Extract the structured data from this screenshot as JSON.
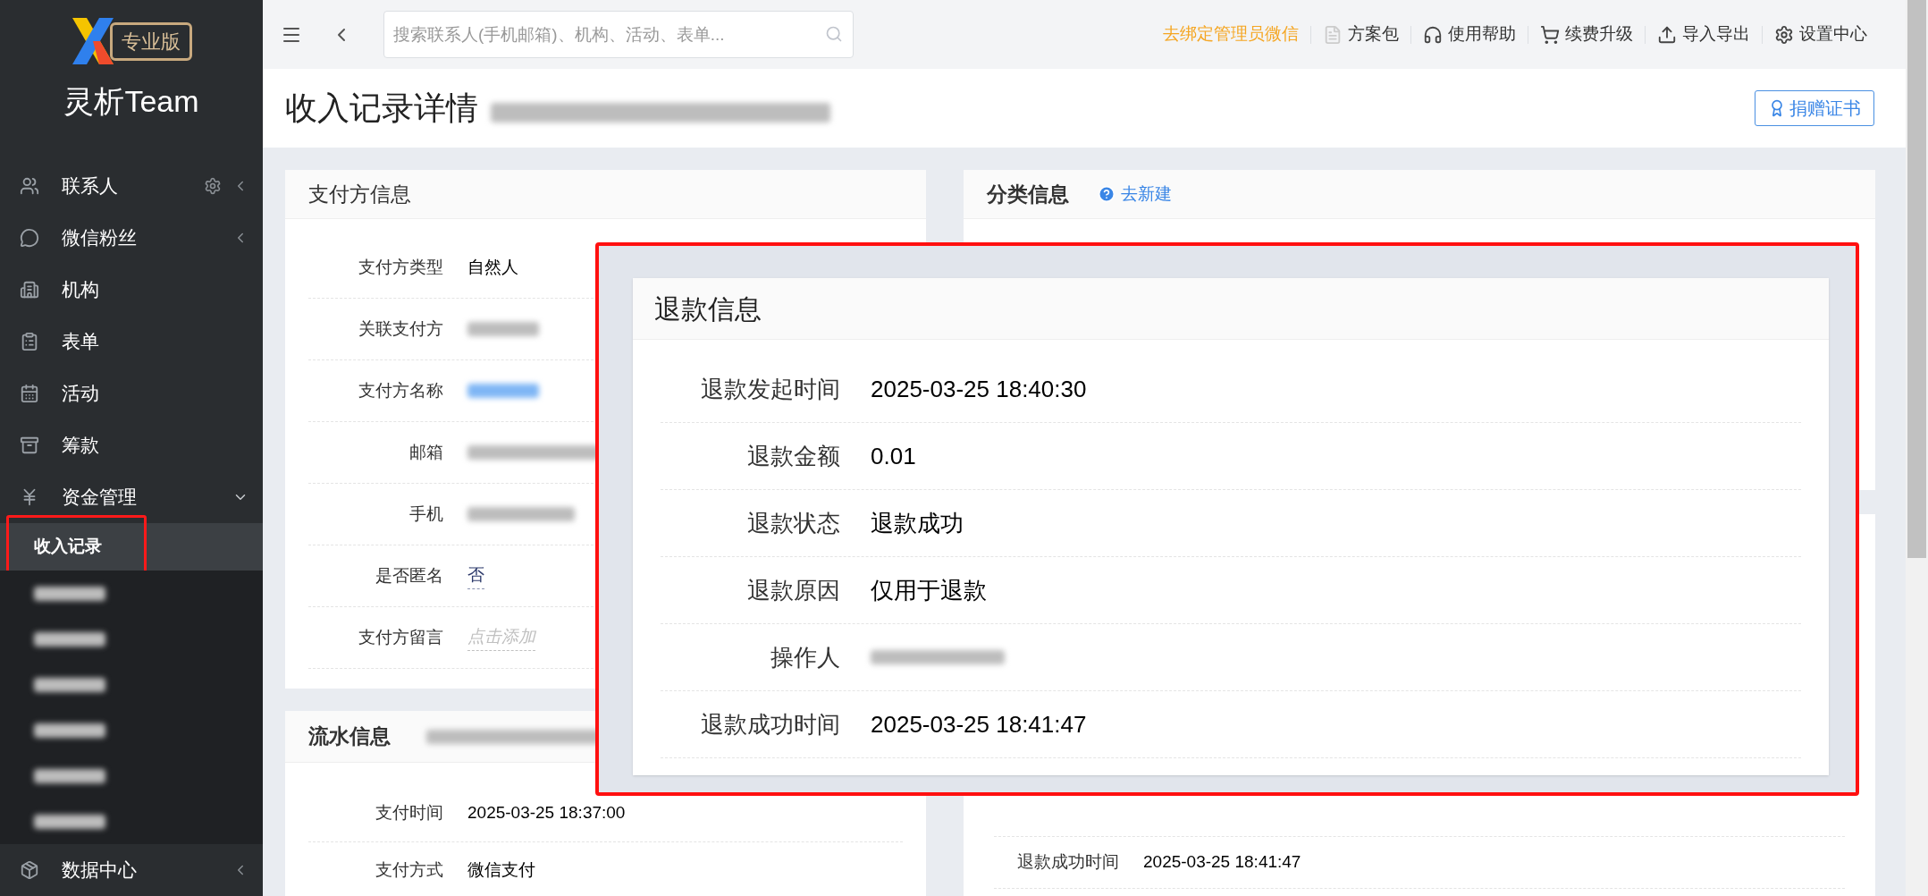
{
  "sidebar": {
    "logo_badge": "专业版",
    "brand": "灵析Team",
    "items": [
      {
        "label": "联系人",
        "settings": true,
        "expanded": false
      },
      {
        "label": "微信粉丝",
        "expanded": false
      },
      {
        "label": "机构"
      },
      {
        "label": "表单"
      },
      {
        "label": "活动"
      },
      {
        "label": "筹款"
      },
      {
        "label": "资金管理",
        "expanded": true,
        "children": [
          {
            "label": "收入记录",
            "selected": true,
            "highlighted": true,
            "redacted": false
          },
          {
            "redacted": true,
            "selected": false,
            "highlighted": false
          },
          {
            "redacted": true,
            "selected": false,
            "highlighted": false
          },
          {
            "redacted": true,
            "selected": false,
            "highlighted": false
          },
          {
            "redacted": true,
            "selected": false,
            "highlighted": false
          },
          {
            "redacted": true,
            "selected": false,
            "highlighted": false
          },
          {
            "redacted": true,
            "selected": false,
            "highlighted": false
          }
        ]
      },
      {
        "label": "数据中心",
        "expanded": false
      }
    ]
  },
  "top_bar": {
    "search": {
      "placeholder": "搜索联系人(手机邮箱)、机构、活动、表单..."
    },
    "links": [
      {
        "label": "去绑定管理员微信",
        "kind": "notice"
      },
      {
        "label": "方案包",
        "kind": "disabled"
      },
      {
        "label": "使用帮助",
        "kind": "normal"
      },
      {
        "label": "续费升级",
        "kind": "normal"
      },
      {
        "label": "导入导出",
        "kind": "normal"
      },
      {
        "label": "设置中心",
        "kind": "normal"
      }
    ]
  },
  "page": {
    "title": "收入记录详情",
    "subtitle_redacted": true,
    "button": "捐赠证书"
  },
  "payer_info": {
    "title": "支付方信息",
    "rows": [
      {
        "label": "支付方类型",
        "kind": "text",
        "value": "自然人"
      },
      {
        "label": "关联支付方",
        "kind": "redacted"
      },
      {
        "label": "支付方名称",
        "kind": "redacted_link"
      },
      {
        "label": "邮箱",
        "kind": "redacted"
      },
      {
        "label": "手机",
        "kind": "redacted"
      },
      {
        "label": "是否匿名",
        "kind": "editable",
        "value": "否"
      },
      {
        "label": "支付方留言",
        "kind": "placeholder",
        "value": "点击添加"
      }
    ]
  },
  "flow_info": {
    "title": "流水信息",
    "subtitle_redacted": true,
    "rows": [
      {
        "label": "支付时间",
        "kind": "text",
        "value": "2025-03-25 18:37:00"
      },
      {
        "label": "支付方式",
        "kind": "text",
        "value": "微信支付"
      }
    ]
  },
  "category_info": {
    "title": "分类信息",
    "link": "去新建"
  },
  "refund_info": {
    "rows": [
      {
        "label": "退款成功时间",
        "kind": "text",
        "value": "2025-03-25 18:41:47"
      }
    ]
  },
  "refund_zoom": {
    "highlighted": true,
    "title": "退款信息",
    "rows": [
      {
        "label": "退款发起时间",
        "kind": "text",
        "value": "2025-03-25 18:40:30"
      },
      {
        "label": "退款金额",
        "kind": "text",
        "value": "0.01"
      },
      {
        "label": "退款状态",
        "kind": "text",
        "value": "退款成功"
      },
      {
        "label": "退款原因",
        "kind": "text",
        "value": "仅用于退款"
      },
      {
        "label": "操作人",
        "kind": "redacted"
      },
      {
        "label": "退款成功时间",
        "kind": "text",
        "value": "2025-03-25 18:41:47"
      }
    ]
  }
}
